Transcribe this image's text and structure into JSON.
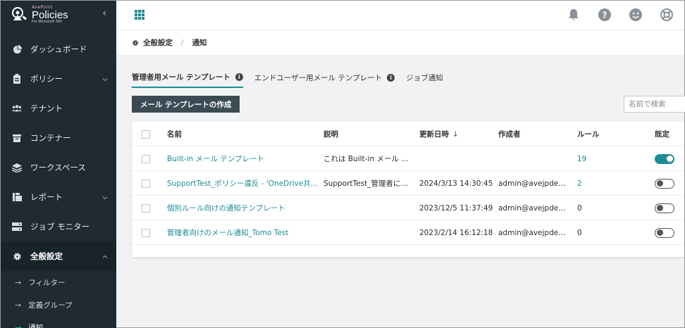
{
  "brand": {
    "vendor": "AvePoint",
    "product": "Policies",
    "sub": "For Microsoft 365"
  },
  "sidebar": {
    "items": [
      {
        "label": "ダッシュボード",
        "icon": "pie-chart-icon"
      },
      {
        "label": "ポリシー",
        "icon": "clipboard-icon",
        "expandable": true
      },
      {
        "label": "テナント",
        "icon": "users-icon"
      },
      {
        "label": "コンテナー",
        "icon": "box-icon"
      },
      {
        "label": "ワークスペース",
        "icon": "layers-icon"
      },
      {
        "label": "レポート",
        "icon": "report-icon",
        "expandable": true
      },
      {
        "label": "ジョブ モニター",
        "icon": "monitor-icon"
      },
      {
        "label": "全般設定",
        "icon": "gear-icon",
        "expandable": true,
        "active": true
      }
    ],
    "subitems": [
      {
        "label": "フィルター"
      },
      {
        "label": "定義グループ"
      },
      {
        "label": "通知",
        "active": true
      }
    ]
  },
  "breadcrumb": {
    "parent": "全般設定",
    "current": "通知"
  },
  "tabs": [
    {
      "label": "管理者用メール テンプレート",
      "info": true,
      "active": true
    },
    {
      "label": "エンドユーザー用メール テンプレート",
      "info": true
    },
    {
      "label": "ジョブ通知",
      "info": false
    }
  ],
  "create_button": "メール テンプレートの作成",
  "search": {
    "placeholder": "名前で検索"
  },
  "table": {
    "columns": {
      "name": "名前",
      "desc": "説明",
      "updated": "更新日時",
      "author": "作成者",
      "rules": "ルール",
      "default": "既定"
    },
    "sort_arrow": "↓",
    "rows": [
      {
        "name": "Built-in メール テンプレート",
        "desc": "これは Built-in メール テンプレ…",
        "updated": "",
        "author": "",
        "rules": "19",
        "rules_link": true,
        "default": true
      },
      {
        "name": "SupportTest_ポリシー違反 - 'OneDrive共有解除' 内の",
        "desc": "SupportTest_管理者によっ…",
        "updated": "2024/3/13 14:30:45",
        "author": "admin@avejpdemo.…",
        "rules": "2",
        "rules_link": true,
        "default": false
      },
      {
        "name": "個別ルール向けの通知テンプレート",
        "desc": "",
        "updated": "2023/12/5 11:37:49",
        "author": "admin@avejpdemo.…",
        "rules": "0",
        "rules_link": false,
        "default": false
      },
      {
        "name": "管理者向けのメール通知_Tomo Test",
        "desc": "",
        "updated": "2023/2/14 16:12:18",
        "author": "admin@avejpdemo.…",
        "rules": "0",
        "rules_link": false,
        "default": false
      }
    ]
  },
  "colors": {
    "sidebar_bg": "#1f2a32",
    "accent": "#1c8c97",
    "button_bg": "#3c4a54",
    "content_bg": "#f1f2f3"
  }
}
